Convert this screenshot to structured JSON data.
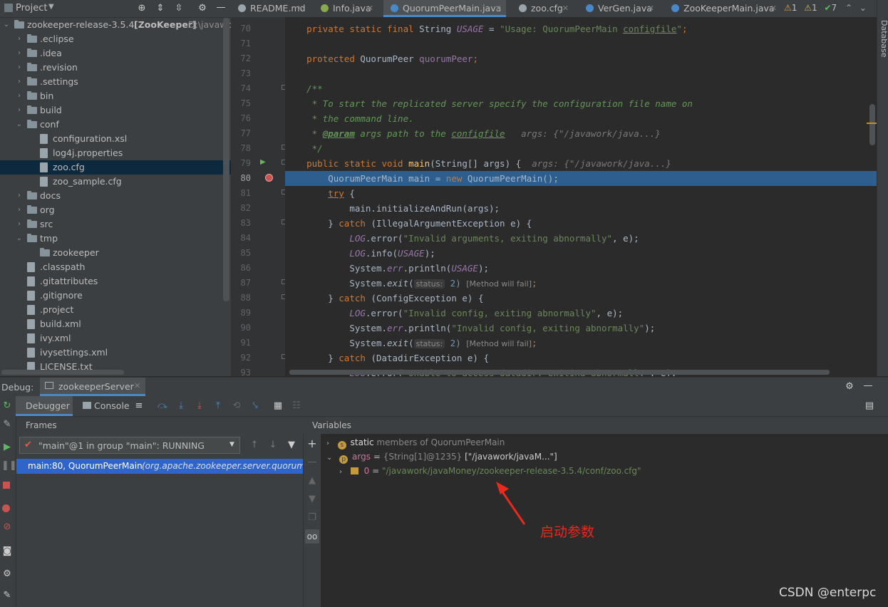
{
  "project": {
    "title": "Project",
    "tree": [
      {
        "label": "zookeeper-release-3.5.4",
        "bold_suffix": "[ZooKeeper]",
        "path_suffix": "D:\\javawo",
        "kind": "root"
      },
      {
        "label": ".eclipse",
        "kind": "folder"
      },
      {
        "label": ".idea",
        "kind": "folder"
      },
      {
        "label": ".revision",
        "kind": "folder"
      },
      {
        "label": ".settings",
        "kind": "folder"
      },
      {
        "label": "bin",
        "kind": "folder"
      },
      {
        "label": "build",
        "kind": "folder"
      },
      {
        "label": "conf",
        "kind": "folder-open"
      },
      {
        "label": "configuration.xsl",
        "kind": "file"
      },
      {
        "label": "log4j.properties",
        "kind": "file"
      },
      {
        "label": "zoo.cfg",
        "kind": "file"
      },
      {
        "label": "zoo_sample.cfg",
        "kind": "file"
      },
      {
        "label": "docs",
        "kind": "folder"
      },
      {
        "label": "org",
        "kind": "folder"
      },
      {
        "label": "src",
        "kind": "folder"
      },
      {
        "label": "tmp",
        "kind": "folder-open"
      },
      {
        "label": "zookeeper",
        "kind": "folder"
      },
      {
        "label": ".classpath",
        "kind": "file"
      },
      {
        "label": ".gitattributes",
        "kind": "file"
      },
      {
        "label": ".gitignore",
        "kind": "file"
      },
      {
        "label": ".project",
        "kind": "file"
      },
      {
        "label": "build.xml",
        "kind": "file"
      },
      {
        "label": "ivy.xml",
        "kind": "file"
      },
      {
        "label": "ivysettings.xml",
        "kind": "file"
      },
      {
        "label": "LICENSE.txt",
        "kind": "file"
      }
    ]
  },
  "editor": {
    "tabs": [
      "README.md",
      "Info.java",
      "QuorumPeerMain.java",
      "zoo.cfg",
      "VerGen.java",
      "ZooKeeperMain.java"
    ],
    "active_tab": "QuorumPeerMain.java",
    "inspections": {
      "warn": "1",
      "weak": "1",
      "ok": "7"
    },
    "line_numbers": [
      "70",
      "71",
      "72",
      "73",
      "74",
      "75",
      "76",
      "77",
      "78",
      "79",
      "80",
      "81",
      "82",
      "83",
      "84",
      "85",
      "86",
      "87",
      "88",
      "89",
      "90",
      "91",
      "92",
      "93"
    ],
    "code": {
      "l70_a": "private static final ",
      "l70_b": "String ",
      "l70_c": "USAGE",
      "l70_d": " = ",
      "l70_e": "\"Usage: QuorumPeerMain ",
      "l70_f": "configfile",
      "l70_g": "\"",
      "l70_h": ";",
      "l72_a": "protected ",
      "l72_b": "QuorumPeer ",
      "l72_c": "quorumPeer",
      "l72_d": ";",
      "l74": "/**",
      "l75": " * To start the replicated server specify the configuration file name on",
      "l76": " * the command line.",
      "l77_a": " * ",
      "l77_b": "@param",
      "l77_c": " args path to the ",
      "l77_d": "configfile",
      "l77_hint": "args: {\"/javawork/java...}",
      "l78": " */",
      "l79_a": "public static void ",
      "l79_b": "main",
      "l79_c": "(String[] args) {",
      "l79_hint": "args: {\"/javawork/java...}",
      "l80_a": "QuorumPeerMain main = ",
      "l80_b": "new ",
      "l80_c": "QuorumPeerMain();",
      "l81_a": "try",
      "l81_b": " {",
      "l82": "main.initializeAndRun(args);",
      "l83_a": "} ",
      "l83_b": "catch ",
      "l83_c": "(IllegalArgumentException e) {",
      "l84_a": "LOG",
      "l84_b": ".error(",
      "l84_c": "\"Invalid arguments, exiting abnormally\"",
      "l84_d": ", e);",
      "l85_a": "LOG",
      "l85_b": ".info(",
      "l85_c": "USAGE",
      "l85_d": ");",
      "l86_a": "System.",
      "l86_b": "err",
      "l86_c": ".println(",
      "l86_d": "USAGE",
      "l86_e": ");",
      "l87_a": "System.",
      "l87_b": "exit",
      "l87_c": "(",
      "l87_inlay": "status:",
      "l87_d": " 2)",
      "l87_mwf": "[Method will fail]",
      "l87_e": ";",
      "l88_a": "} ",
      "l88_b": "catch ",
      "l88_c": "(ConfigException e) {",
      "l89_a": "LOG",
      "l89_b": ".error(",
      "l89_c": "\"Invalid config, exiting abnormally\"",
      "l89_d": ", e);",
      "l90_a": "System.",
      "l90_b": "err",
      "l90_c": ".println(",
      "l90_d": "\"Invalid config, exiting abnormally\"",
      "l90_e": ");",
      "l91_a": "System.",
      "l91_b": "exit",
      "l91_c": "(",
      "l91_inlay": "status:",
      "l91_d": " 2)",
      "l91_mwf": "[Method will fail]",
      "l91_e": ";",
      "l92_a": "} ",
      "l92_b": "catch ",
      "l92_c": "(DatadirException e) {",
      "l93_a": "LOG",
      "l93_b": ".error(",
      "l93_c": "\"Unable to access datadir, exiting abnormally\"",
      "l93_d": ", e);"
    },
    "right_strip_label": "Database"
  },
  "debug": {
    "label": "Debug:",
    "session": "zookeeperServer",
    "tabs": {
      "debugger": "Debugger",
      "console": "Console"
    },
    "frames_title": "Frames",
    "thread": "\"main\"@1 in group \"main\": RUNNING",
    "frame_method": "main:80, QuorumPeerMain",
    "frame_pkg": "(org.apache.zookeeper.server.quorum)",
    "variables_title": "Variables",
    "vars": {
      "static_label": "static",
      "static_rest": "members of QuorumPeerMain",
      "args_name": "args",
      "args_eq": " = ",
      "args_type": "{String[1]@1235}",
      "args_val": " [\"/javawork/javaM...\"]",
      "elem_name": "0",
      "elem_eq": " = ",
      "elem_val": "\"/javawork/javaMoney/zookeeper-release-3.5.4/conf/zoo.cfg\""
    }
  },
  "annotation": {
    "text": "启动参数",
    "color": "#e8291c"
  },
  "watermark": "CSDN @enterpc",
  "colors": {
    "accent": "#4a88c7",
    "selection": "#2d5e8e",
    "keyword": "#cc7832",
    "string": "#6a8759"
  }
}
